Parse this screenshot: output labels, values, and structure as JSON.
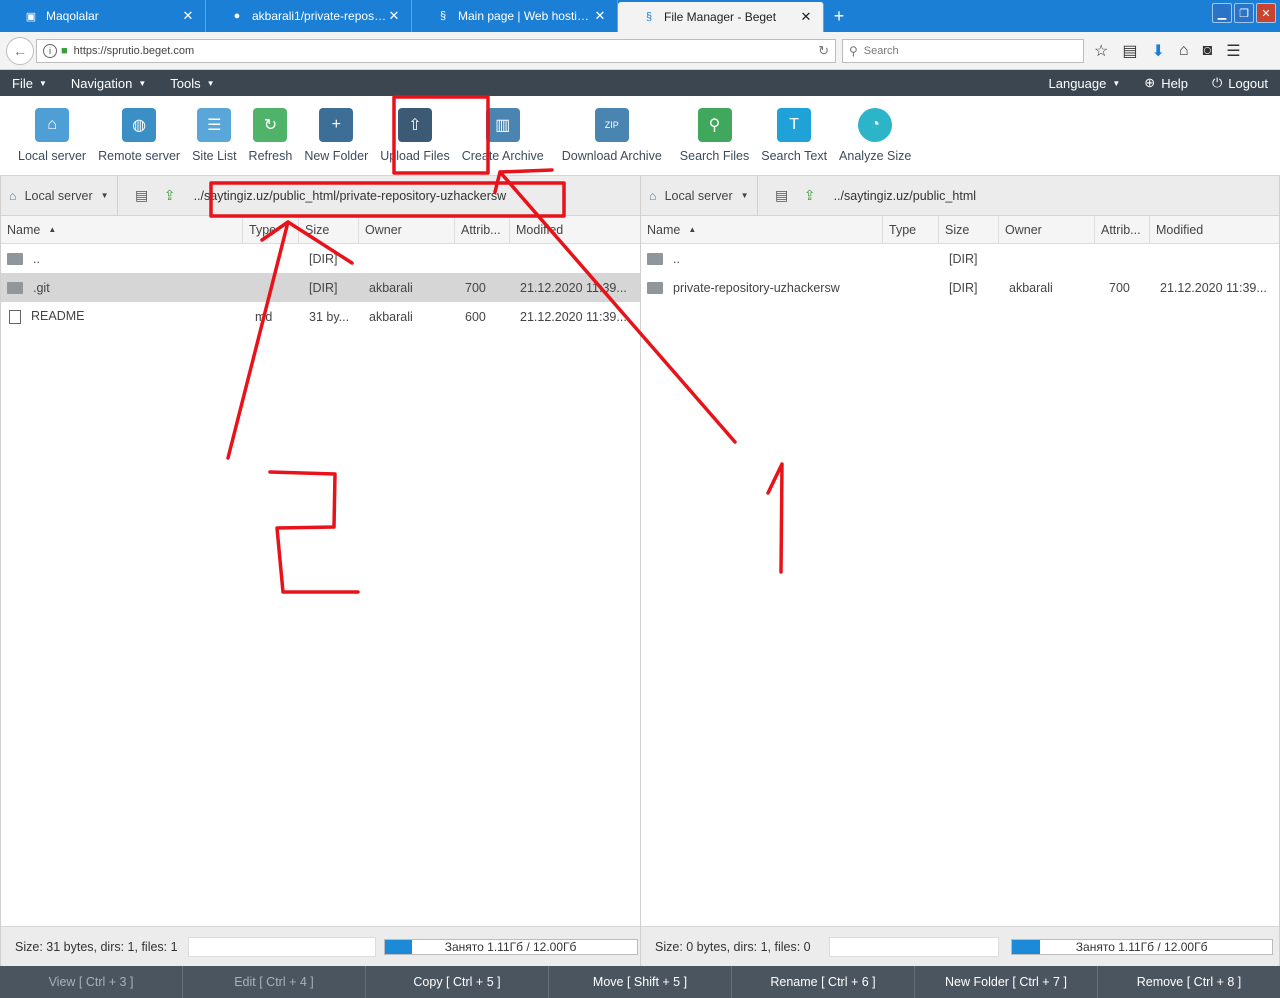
{
  "browser": {
    "tabs": [
      {
        "label": "Maqolalar",
        "active": false
      },
      {
        "label": "akbarali1/private-repository-...",
        "active": false
      },
      {
        "label": "Main page | Web hosting cont...",
        "active": false
      },
      {
        "label": "File Manager - Beget",
        "active": true
      }
    ],
    "new_tab": "+",
    "url": "https://sprutio.beget.com",
    "search_placeholder": "Search"
  },
  "menu": {
    "left": [
      "File",
      "Navigation",
      "Tools"
    ],
    "right": [
      "Language",
      "Help",
      "Logout"
    ]
  },
  "toolbar": {
    "items": [
      {
        "label": "Local server",
        "icon": "house-icon"
      },
      {
        "label": "Remote server",
        "icon": "globe-server-icon"
      },
      {
        "label": "Site List",
        "icon": "site-list-icon"
      },
      {
        "label": "Refresh",
        "icon": "refresh-icon"
      },
      {
        "label": "New Folder",
        "icon": "new-folder-icon"
      },
      {
        "label": "Upload Files",
        "icon": "upload-icon"
      },
      {
        "label": "Create Archive",
        "icon": "archive-icon"
      },
      {
        "label": "Download Archive",
        "icon": "zip-icon"
      },
      {
        "label": "Search Files",
        "icon": "search-files-icon"
      },
      {
        "label": "Search Text",
        "icon": "search-text-icon"
      },
      {
        "label": "Analyze Size",
        "icon": "pie-icon"
      }
    ]
  },
  "columns": {
    "name": "Name",
    "type": "Type",
    "size": "Size",
    "owner": "Owner",
    "attr": "Attrib...",
    "modified": "Modified"
  },
  "left_panel": {
    "server": "Local server",
    "path": "../saytingiz.uz/public_html/private-repository-uzhackersw",
    "rows": [
      {
        "name": "..",
        "type": "",
        "size": "[DIR]",
        "owner": "",
        "attr": "",
        "modified": ""
      },
      {
        "name": ".git",
        "type": "",
        "size": "[DIR]",
        "owner": "akbarali",
        "attr": "700",
        "modified": "21.12.2020 11:39..."
      },
      {
        "name": "README",
        "type": "md",
        "size": "31 by...",
        "owner": "akbarali",
        "attr": "600",
        "modified": "21.12.2020 11:39..."
      }
    ],
    "status": "Size: 31 bytes, dirs: 1, files: 1",
    "quota": "Занято 1.11Гб / 12.00Гб",
    "quota_fraction": 0.11
  },
  "right_panel": {
    "server": "Local server",
    "path": "../saytingiz.uz/public_html",
    "rows": [
      {
        "name": "..",
        "type": "",
        "size": "[DIR]",
        "owner": "",
        "attr": "",
        "modified": ""
      },
      {
        "name": "private-repository-uzhackersw",
        "type": "",
        "size": "[DIR]",
        "owner": "akbarali",
        "attr": "700",
        "modified": "21.12.2020 11:39..."
      }
    ],
    "status": "Size: 0 bytes, dirs: 1, files: 0",
    "quota": "Занято 1.11Гб / 12.00Гб",
    "quota_fraction": 0.11
  },
  "fkeys": [
    {
      "label": "View [ Ctrl + 3 ]",
      "disabled": true
    },
    {
      "label": "Edit [ Ctrl + 4 ]",
      "disabled": true
    },
    {
      "label": "Copy [ Ctrl + 5 ]",
      "disabled": false
    },
    {
      "label": "Move [ Shift + 5 ]",
      "disabled": false
    },
    {
      "label": "Rename [ Ctrl + 6 ]",
      "disabled": false
    },
    {
      "label": "New Folder [ Ctrl + 7 ]",
      "disabled": false
    },
    {
      "label": "Remove [ Ctrl + 8 ]",
      "disabled": false
    }
  ],
  "colors": {
    "accent": "#1c7fd6",
    "menu_bg": "#3c4650",
    "annotation": "#e8131a"
  }
}
